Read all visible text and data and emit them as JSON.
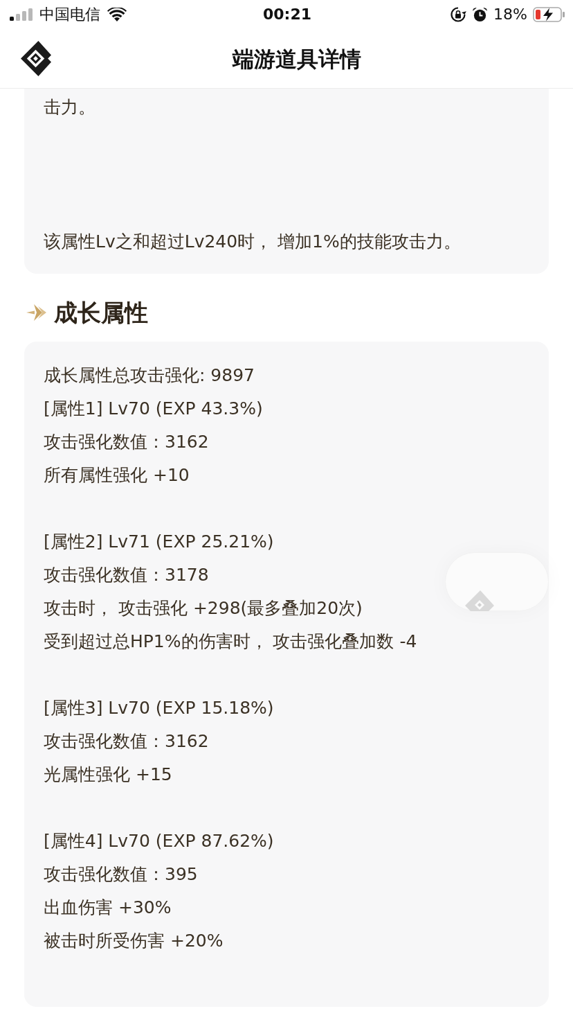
{
  "status_bar": {
    "carrier": "中国电信",
    "time": "00:21",
    "battery": "18%"
  },
  "header": {
    "title": "端游道具详情"
  },
  "description_card": {
    "paragraphs": [
      "击力。",
      "该属性Lv之和超过Lv240时， 增加1%的技能攻击力。"
    ]
  },
  "sections": [
    {
      "title": "成长属性",
      "groups": [
        {
          "lines": [
            "成长属性总攻击强化: 9897",
            "[属性1] Lv70 (EXP 43.3%)",
            "攻击强化数值：3162",
            "所有属性强化 +10"
          ]
        },
        {
          "lines": [
            "[属性2] Lv71 (EXP 25.21%)",
            "攻击强化数值：3178",
            "攻击时， 攻击强化 +298(最多叠加20次)",
            "受到超过总HP1%的伤害时， 攻击强化叠加数 -4"
          ]
        },
        {
          "lines": [
            "[属性3] Lv70 (EXP 15.18%)",
            "攻击强化数值：3162",
            "光属性强化 +15"
          ]
        },
        {
          "lines": [
            "[属性4] Lv70 (EXP 87.62%)",
            "攻击强化数值：395",
            "出血伤害 +30%",
            "被击时所受伤害 +20%"
          ]
        }
      ]
    }
  ]
}
